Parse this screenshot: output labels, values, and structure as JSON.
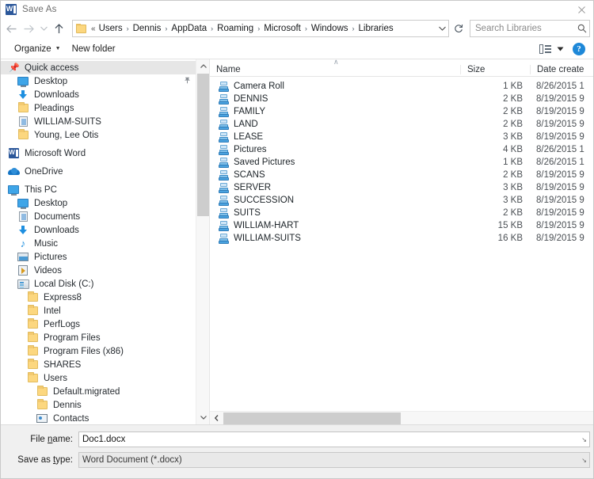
{
  "titlebar": {
    "title": "Save As",
    "app_icon": "word-icon",
    "close_label": "✕"
  },
  "address": {
    "back_icon": "back-arrow-icon",
    "forward_icon": "forward-arrow-icon",
    "recent_icon": "chevron-down-icon",
    "up_icon": "up-arrow-icon",
    "folder_icon": "folder-icon",
    "overflow": "«",
    "crumbs": [
      "Users",
      "Dennis",
      "AppData",
      "Roaming",
      "Microsoft",
      "Windows",
      "Libraries"
    ],
    "separator": "›",
    "dropdown_icon": "chevron-down-icon",
    "refresh_icon": "refresh-icon"
  },
  "search": {
    "placeholder": "Search Libraries",
    "icon": "search-icon"
  },
  "toolbar": {
    "organize_label": "Organize",
    "organize_caret": "▼",
    "new_folder_label": "New folder",
    "view_icon": "view-options-icon",
    "view_caret": "▼",
    "help_label": "?"
  },
  "sidebar": {
    "scroll_up_icon": "∧",
    "scroll_down_icon": "∨",
    "items": [
      {
        "label": "Quick access",
        "icon": "pin-icon",
        "level": 0,
        "selected": true,
        "gap": false
      },
      {
        "label": "Desktop",
        "icon": "monitor-icon",
        "level": 1,
        "selected": false,
        "gap": false,
        "pinned": true
      },
      {
        "label": "Downloads",
        "icon": "download-icon",
        "level": 1,
        "selected": false,
        "gap": false
      },
      {
        "label": "Pleadings",
        "icon": "folder-icon",
        "level": 1,
        "selected": false,
        "gap": false
      },
      {
        "label": "WILLIAM-SUITS",
        "icon": "document-icon",
        "level": 1,
        "selected": false,
        "gap": false
      },
      {
        "label": "Young, Lee Otis",
        "icon": "folder-icon",
        "level": 1,
        "selected": false,
        "gap": false
      },
      {
        "label": "Microsoft Word",
        "icon": "word-icon",
        "level": 0,
        "selected": false,
        "gap": true
      },
      {
        "label": "OneDrive",
        "icon": "cloud-icon",
        "level": 0,
        "selected": false,
        "gap": true
      },
      {
        "label": "This PC",
        "icon": "computer-icon",
        "level": 0,
        "selected": false,
        "gap": true
      },
      {
        "label": "Desktop",
        "icon": "monitor-icon",
        "level": 1,
        "selected": false,
        "gap": false
      },
      {
        "label": "Documents",
        "icon": "document-icon",
        "level": 1,
        "selected": false,
        "gap": false
      },
      {
        "label": "Downloads",
        "icon": "download-icon",
        "level": 1,
        "selected": false,
        "gap": false
      },
      {
        "label": "Music",
        "icon": "music-icon",
        "level": 1,
        "selected": false,
        "gap": false
      },
      {
        "label": "Pictures",
        "icon": "pictures-icon",
        "level": 1,
        "selected": false,
        "gap": false
      },
      {
        "label": "Videos",
        "icon": "video-icon",
        "level": 1,
        "selected": false,
        "gap": false
      },
      {
        "label": "Local Disk (C:)",
        "icon": "drive-icon",
        "level": 1,
        "selected": false,
        "gap": false
      },
      {
        "label": "Express8",
        "icon": "folder-icon",
        "level": 2,
        "selected": false,
        "gap": false
      },
      {
        "label": "Intel",
        "icon": "folder-icon",
        "level": 2,
        "selected": false,
        "gap": false
      },
      {
        "label": "PerfLogs",
        "icon": "folder-icon",
        "level": 2,
        "selected": false,
        "gap": false
      },
      {
        "label": "Program Files",
        "icon": "folder-icon",
        "level": 2,
        "selected": false,
        "gap": false
      },
      {
        "label": "Program Files (x86)",
        "icon": "folder-icon",
        "level": 2,
        "selected": false,
        "gap": false
      },
      {
        "label": "SHARES",
        "icon": "folder-icon",
        "level": 2,
        "selected": false,
        "gap": false
      },
      {
        "label": "Users",
        "icon": "folder-icon",
        "level": 2,
        "selected": false,
        "gap": false
      },
      {
        "label": "Default.migrated",
        "icon": "folder-icon",
        "level": 3,
        "selected": false,
        "gap": false
      },
      {
        "label": "Dennis",
        "icon": "folder-icon",
        "level": 3,
        "selected": false,
        "gap": false
      },
      {
        "label": "Contacts",
        "icon": "contacts-icon",
        "level": 3,
        "selected": false,
        "gap": false
      }
    ]
  },
  "filelist": {
    "sort_caret": "∧",
    "columns": {
      "name": "Name",
      "size": "Size",
      "date": "Date create"
    },
    "rows": [
      {
        "name": "Camera Roll",
        "icon": "library-icon",
        "size": "1 KB",
        "date": "8/26/2015 1"
      },
      {
        "name": "DENNIS",
        "icon": "library-icon",
        "size": "2 KB",
        "date": "8/19/2015 9"
      },
      {
        "name": "FAMILY",
        "icon": "library-icon",
        "size": "2 KB",
        "date": "8/19/2015 9"
      },
      {
        "name": "LAND",
        "icon": "library-icon",
        "size": "2 KB",
        "date": "8/19/2015 9"
      },
      {
        "name": "LEASE",
        "icon": "library-icon",
        "size": "3 KB",
        "date": "8/19/2015 9"
      },
      {
        "name": "Pictures",
        "icon": "library-icon",
        "size": "4 KB",
        "date": "8/26/2015 1"
      },
      {
        "name": "Saved Pictures",
        "icon": "library-icon",
        "size": "1 KB",
        "date": "8/26/2015 1"
      },
      {
        "name": "SCANS",
        "icon": "library-icon",
        "size": "2 KB",
        "date": "8/19/2015 9"
      },
      {
        "name": "SERVER",
        "icon": "library-icon",
        "size": "3 KB",
        "date": "8/19/2015 9"
      },
      {
        "name": "SUCCESSION",
        "icon": "library-icon",
        "size": "3 KB",
        "date": "8/19/2015 9"
      },
      {
        "name": "SUITS",
        "icon": "library-icon",
        "size": "2 KB",
        "date": "8/19/2015 9"
      },
      {
        "name": "WILLIAM-HART",
        "icon": "library-icon",
        "size": "15 KB",
        "date": "8/19/2015 9"
      },
      {
        "name": "WILLIAM-SUITS",
        "icon": "library-icon",
        "size": "16 KB",
        "date": "8/19/2015 9"
      }
    ],
    "hscroll_left_icon": "‹"
  },
  "footer": {
    "filename_label_pre": "File ",
    "filename_label_key": "n",
    "filename_label_post": "ame:",
    "filename_value": "Doc1.docx",
    "savetype_label_pre": "Save as ",
    "savetype_label_key": "t",
    "savetype_label_post": "ype:",
    "savetype_value": "Word Document (*.docx)",
    "caret_icon": "↘"
  }
}
